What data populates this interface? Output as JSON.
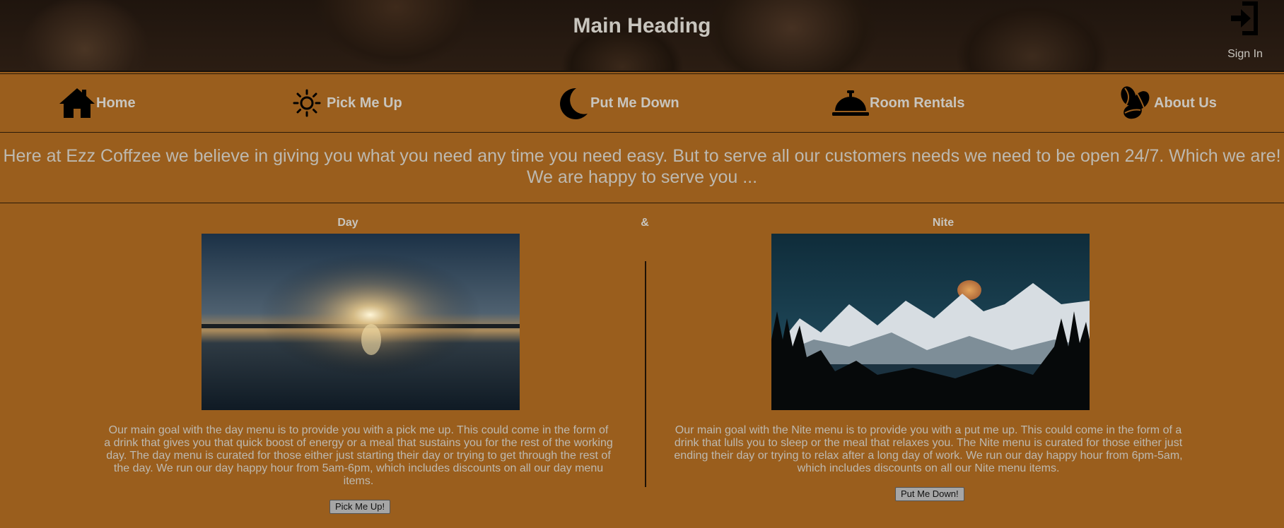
{
  "header": {
    "title": "Main Heading",
    "signin_label": "Sign In",
    "signin_icon": "sign-in-icon"
  },
  "nav": {
    "items": [
      {
        "label": "Home",
        "icon": "home-icon"
      },
      {
        "label": "Pick Me Up",
        "icon": "sun-icon"
      },
      {
        "label": "Put Me Down",
        "icon": "moon-icon"
      },
      {
        "label": "Room Rentals",
        "icon": "concierge-bell-icon"
      },
      {
        "label": "About Us",
        "icon": "coffee-beans-icon"
      }
    ]
  },
  "intro": {
    "line1": "Here at Ezz Coffzee we believe in giving you what you need any time you need easy. But to serve all our customers needs we need to be open 24/7. Which we are!",
    "line2": "We are happy to serve you ..."
  },
  "menus": {
    "day": {
      "title": "Day",
      "description": "Our main goal with the day menu is to provide you with a pick me up. This could come in the form of a drink that gives you that quick boost of energy or a meal that sustains you for the rest of the working day. The day menu is curated for those either just starting their day or trying to get through the rest of the day. We run our day happy hour from 5am-6pm, which includes discounts on all our day menu items.",
      "button": "Pick Me Up!"
    },
    "ampersand": "&",
    "nite": {
      "title": "Nite",
      "description": "Our main goal with the Nite menu is to provide you with a put me up. This could come in the form of a drink that lulls you to sleep or the meal that relaxes you. The Nite menu is curated for those either just ending their day or trying to relax after a long day of work. We run our day happy hour from 6pm-5am, which includes discounts on all our Nite menu items.",
      "button": "Put Me Down!"
    }
  },
  "colors": {
    "background": "#9a5e1d",
    "text": "#bdb9b0",
    "icon": "#000000"
  }
}
